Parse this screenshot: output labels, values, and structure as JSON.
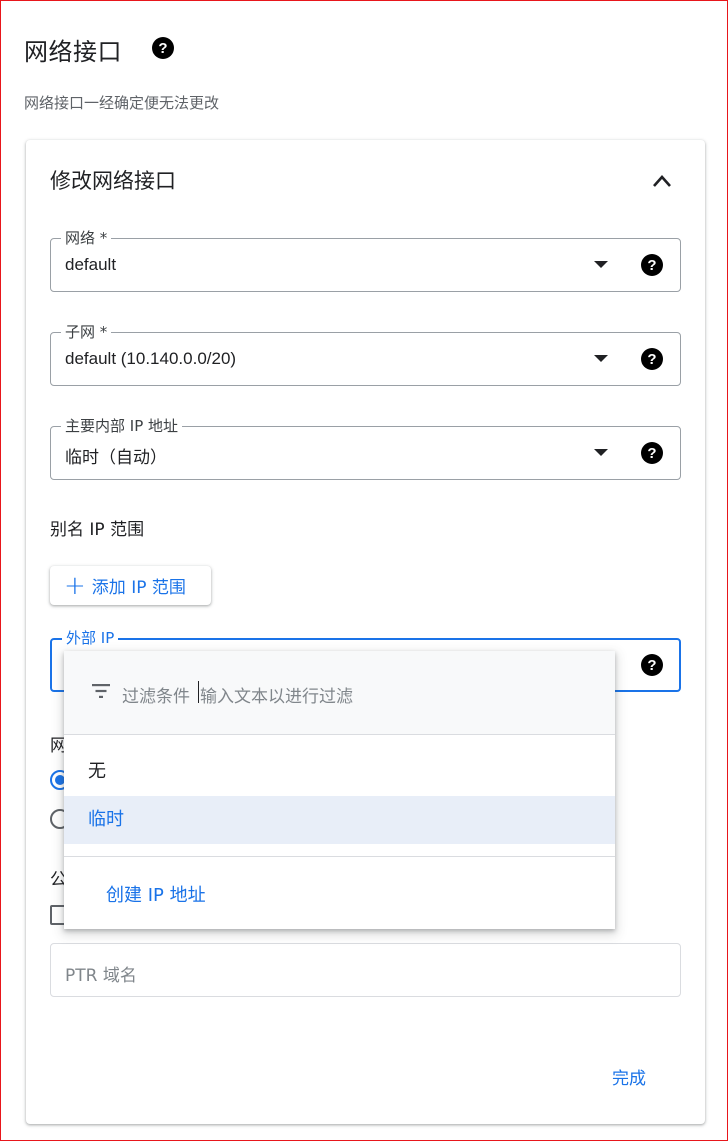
{
  "header": {
    "title": "网络接口",
    "subtitle": "网络接口一经确定便无法更改"
  },
  "card": {
    "title": "修改网络接口"
  },
  "fields": {
    "network": {
      "label": "网络 *",
      "value": "default"
    },
    "subnet": {
      "label": "子网 *",
      "value": "default (10.140.0.0/20)"
    },
    "internal_ip": {
      "label": "主要内部 IP 地址",
      "value": "临时（自动）"
    },
    "external_ip": {
      "label": "外部 IP"
    }
  },
  "alias": {
    "label": "别名 IP 范围",
    "add_button_label": "添加 IP 范围"
  },
  "partial": {
    "network_tier_prefix": "网",
    "public_dns_prefix": "公"
  },
  "ptr": {
    "placeholder": "PTR 域名"
  },
  "done_label": "完成",
  "menu": {
    "filter_label": "过滤条件",
    "filter_placeholder": "输入文本以进行过滤",
    "items": [
      {
        "label": "无",
        "selected": false
      },
      {
        "label": "临时",
        "selected": true
      }
    ],
    "action_label": "创建 IP 地址"
  },
  "icons": {
    "help": "help-circle-icon",
    "expand": "chevron-up-icon",
    "dropdown": "arrow-drop-down-icon",
    "add": "plus-icon",
    "filter": "filter-list-icon"
  },
  "colors": {
    "accent": "#1a73e8",
    "selected_bg": "#e8eef8",
    "frame_border": "#e8161b"
  }
}
